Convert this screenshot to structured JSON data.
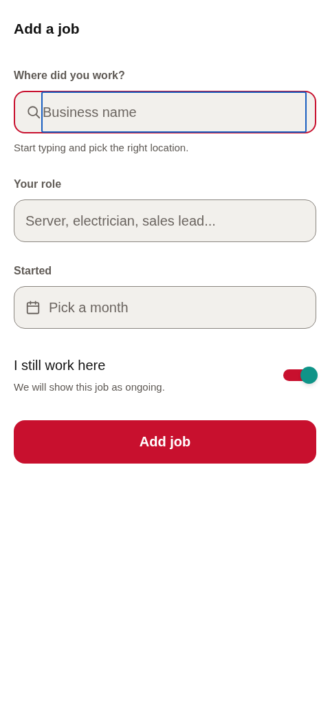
{
  "title": "Add a job",
  "fields": [
    {
      "kind": "search",
      "label": "Where did you work?",
      "placeholder": "Business name",
      "hint": "Start typing and pick the right location.",
      "invalid": true,
      "focused": true
    },
    {
      "kind": "text",
      "label": "Your role",
      "placeholder": "Server, electrician, sales lead...",
      "invalid": false,
      "focused": false
    },
    {
      "kind": "month",
      "label": "Started",
      "placeholder": "Pick a month",
      "invalid": false,
      "focused": false
    }
  ],
  "toggle": {
    "label": "I still work here",
    "description": "We will show this job as ongoing.",
    "on": true
  },
  "submit": "Add job"
}
